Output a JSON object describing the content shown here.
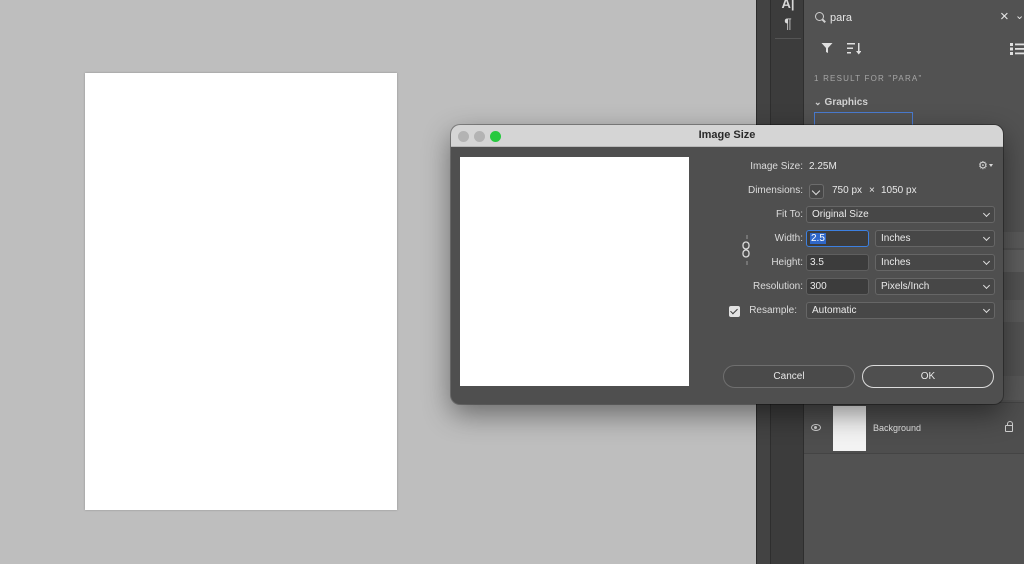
{
  "sidebar": {
    "search_value": "para",
    "result_count": "1 RESULT FOR \"PARA\"",
    "section_title": "Graphics",
    "layer_name": "Background"
  },
  "dialog": {
    "title": "Image Size",
    "image_size_label": "Image Size:",
    "image_size_value": "2.25M",
    "dimensions_label": "Dimensions:",
    "dim_width": "750 px",
    "dim_sep": "×",
    "dim_height": "1050 px",
    "fit_to_label": "Fit To:",
    "fit_to_value": "Original Size",
    "width_label": "Width:",
    "width_value": "2.5",
    "width_unit": "Inches",
    "height_label": "Height:",
    "height_value": "3.5",
    "height_unit": "Inches",
    "resolution_label": "Resolution:",
    "resolution_value": "300",
    "resolution_unit": "Pixels/Inch",
    "resample_label": "Resample:",
    "resample_value": "Automatic",
    "resample_checked": true,
    "cancel_label": "Cancel",
    "ok_label": "OK"
  },
  "colors": {
    "canvas_bg": "#bebebe",
    "panel_bg": "#525252",
    "dialog_bg": "#4f4f4f",
    "titlebar_bg": "#d5d5d5",
    "accent": "#2f67c9",
    "zoom_light": "#27c93f"
  },
  "icons": [
    "character-icon",
    "paragraph-icon",
    "search-icon",
    "close-icon",
    "chevron-down-icon",
    "filter-icon",
    "sort-icon",
    "list-icon",
    "eye-icon",
    "lock-icon",
    "gear-icon",
    "link-icon",
    "checkbox-icon"
  ]
}
